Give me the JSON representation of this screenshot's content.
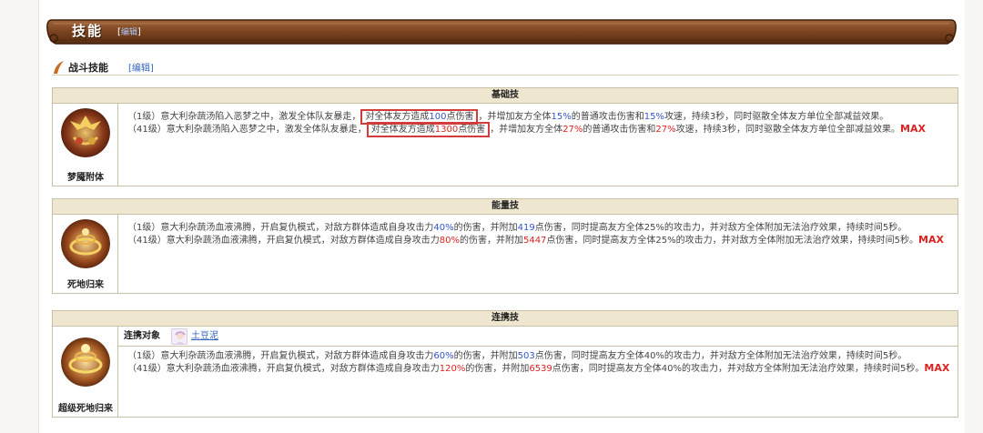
{
  "section": {
    "title": "技能",
    "edit_open": "[",
    "edit_label": "编辑",
    "edit_close": "]"
  },
  "subsection": {
    "title": "战斗技能",
    "edit_text": "[编辑]"
  },
  "skills": [
    {
      "category": "基础技",
      "name": "梦魇附体",
      "lines": [
        {
          "level": "（1级）",
          "pre": "意大利杂蔬汤陷入恶梦之中，激发全体队友暴走，",
          "boxed_pre": "对全体友方造成",
          "boxed_num": "100",
          "boxed_post": "点伤害",
          "post1": "，并增加友方全体",
          "pct1": "15%",
          "post2": "的普通攻击伤害和",
          "pct2": "15%",
          "post3": "攻速，持续3秒，同时驱散全体友方单位全部减益效果。"
        },
        {
          "level": "（41级）",
          "pre": "意大利杂蔬汤陷入恶梦之中，激发全体队友暴走，",
          "boxed_pre": "对全体友方造成",
          "boxed_num": "1300",
          "boxed_post": "点伤害",
          "post1": "，并增加友方全体",
          "pct1": "27%",
          "post2": "的普通攻击伤害和",
          "pct2": "27%",
          "post3": "攻速，持续3秒，同时驱散全体友方单位全部减益效果。",
          "max": "MAX"
        }
      ]
    },
    {
      "category": "能量技",
      "name": "死地归来",
      "lines": [
        {
          "level": "（1级）",
          "pre": "意大利杂蔬汤血液沸腾，开启复仇模式，对敌方群体造成自身攻击力",
          "pct": "40%",
          "mid": "的伤害，并附加",
          "num": "419",
          "post": "点伤害，同时提高友方全体25%的攻击力，并对敌方全体附加无法治疗效果，持续时间5秒。"
        },
        {
          "level": "（41级）",
          "pre": "意大利杂蔬汤血液沸腾，开启复仇模式，对敌方群体造成自身攻击力",
          "pct": "80%",
          "mid": "的伤害，并附加",
          "num": "5447",
          "post": "点伤害，同时提高友方全体25%的攻击力，并对敌方全体附加无法治疗效果，持续时间5秒。",
          "max": "MAX"
        }
      ]
    },
    {
      "category": "连携技",
      "name": "超级死地归来",
      "link_label": "连携对象",
      "link_target": "土豆泥",
      "lines": [
        {
          "level": "（1级）",
          "pre": "意大利杂蔬汤血液沸腾，开启复仇模式，对敌方群体造成自身攻击力",
          "pct": "60%",
          "mid": "的伤害，并附加",
          "num": "503",
          "post": "点伤害，同时提高友方全体40%的攻击力，并对敌方全体附加无法治疗效果，持续时间5秒。"
        },
        {
          "level": "（41级）",
          "pre": "意大利杂蔬汤血液沸腾，开启复仇模式，对敌方群体造成自身攻击力",
          "pct": "120%",
          "mid": "的伤害，并附加",
          "num": "6539",
          "post": "点伤害，同时提高友方全体40%的攻击力，并对敌方全体附加无法治疗效果，持续时间5秒。",
          "max": "MAX"
        }
      ]
    }
  ]
}
